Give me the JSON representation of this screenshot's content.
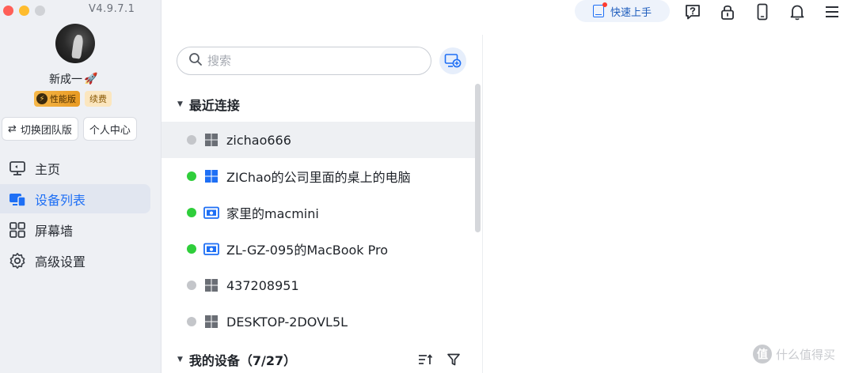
{
  "app": {
    "version": "V4.9.7.1"
  },
  "user": {
    "nickname": "新成一",
    "badge_performance": "性能版",
    "badge_renew": "续费"
  },
  "sidebar": {
    "switch_team_label": "切换团队版",
    "personal_center_label": "个人中心",
    "items": [
      {
        "label": "主页",
        "icon": "monitor-icon",
        "active": false
      },
      {
        "label": "设备列表",
        "icon": "device-list-icon",
        "active": true
      },
      {
        "label": "屏幕墙",
        "icon": "grid-icon",
        "active": false
      },
      {
        "label": "高级设置",
        "icon": "gear-icon",
        "active": false
      }
    ]
  },
  "topbar": {
    "quick_start_label": "快速上手",
    "icons": [
      "help-icon",
      "lock-icon",
      "phone-icon",
      "bell-icon",
      "menu-icon"
    ]
  },
  "search": {
    "placeholder": "搜索",
    "value": ""
  },
  "recent": {
    "title": "最近连接",
    "devices": [
      {
        "name": "zichao666",
        "status": "offline",
        "os": "windows",
        "selected": true
      },
      {
        "name": "ZIChao的公司里面的桌上的电脑",
        "status": "online",
        "os": "windows",
        "selected": false
      },
      {
        "name": "家里的macmini",
        "status": "online",
        "os": "mac",
        "selected": false
      },
      {
        "name": "ZL-GZ-095的MacBook Pro",
        "status": "online",
        "os": "mac",
        "selected": false
      },
      {
        "name": "437208951",
        "status": "offline",
        "os": "windows",
        "selected": false
      },
      {
        "name": "DESKTOP-2DOVL5L",
        "status": "offline",
        "os": "windows",
        "selected": false
      }
    ]
  },
  "my_devices": {
    "title": "我的设备（7/27）"
  },
  "colors": {
    "accent": "#1e6ff5",
    "online": "#2fce3b",
    "offline": "#c4c6ca",
    "sidebar_bg": "#eef0f4"
  },
  "watermark": {
    "logo_glyph": "值",
    "text": "什么值得买"
  }
}
